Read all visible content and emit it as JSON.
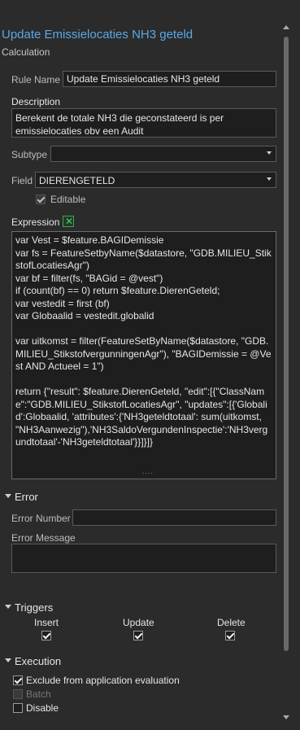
{
  "header": {
    "title": "Update Emissielocaties NH3 geteld",
    "subtitle": "Calculation"
  },
  "rule_name": {
    "label": "Rule Name",
    "value": "Update Emissielocaties NH3 geteld"
  },
  "description": {
    "label": "Description",
    "value": "Berekent de totale NH3 die geconstateerd is per emissielocaties obv een Audit"
  },
  "subtype": {
    "label": "Subtype",
    "value": ""
  },
  "field": {
    "label": "Field",
    "value": "DIERENGETELD",
    "editable_label": "Editable",
    "editable_checked": true
  },
  "expression": {
    "label": "Expression",
    "button_icon": "expression-builder-icon",
    "lines": [
      "var Vest = $feature.BAGIDemissie",
      "var fs = FeatureSetbyName($datastore, \"GDB.MILIEU_StikstofLocatiesAgr\")",
      "var bf = filter(fs, \"BAGid = @vest\")",
      "if (count(bf) == 0) return $feature.DierenGeteld;",
      "var vestedit = first (bf)",
      "var Globaalid = vestedit.globalid",
      "",
      "var uitkomst = filter(FeatureSetByName($datastore, \"GDB.MILIEU_StikstofvergunningenAgr\"), \"BAGIDemissie = @Vest AND Actueel = 1\")",
      "",
      "return {\"result\": $feature.DierenGeteld, \"edit\":[{\"ClassName\":\"GDB.MILIEU_StikstofLocatiesAgr\", \"updates\":[{'Globalid':Globaalid, 'attributes':{'NH3geteldtotaal': sum(uitkomst, \"NH3Aanwezig\"),'NH3SaldoVergundenInspectie':'NH3vergundtotaal'-'NH3geteldtotaal'}}]}]}"
    ]
  },
  "error": {
    "section_label": "Error",
    "number_label": "Error Number",
    "number_value": "",
    "message_label": "Error Message",
    "message_value": ""
  },
  "triggers": {
    "section_label": "Triggers",
    "items": [
      {
        "label": "Insert",
        "checked": true
      },
      {
        "label": "Update",
        "checked": true
      },
      {
        "label": "Delete",
        "checked": true
      }
    ]
  },
  "execution": {
    "section_label": "Execution",
    "exclude_label": "Exclude from application evaluation",
    "exclude_checked": true,
    "batch_label": "Batch",
    "batch_checked": false,
    "batch_disabled": true,
    "disable_label": "Disable",
    "disable_checked": false
  },
  "colors": {
    "background": "#2b2b2b",
    "title_accent": "#5aa9e6",
    "expression_icon": "#4fcf68"
  }
}
